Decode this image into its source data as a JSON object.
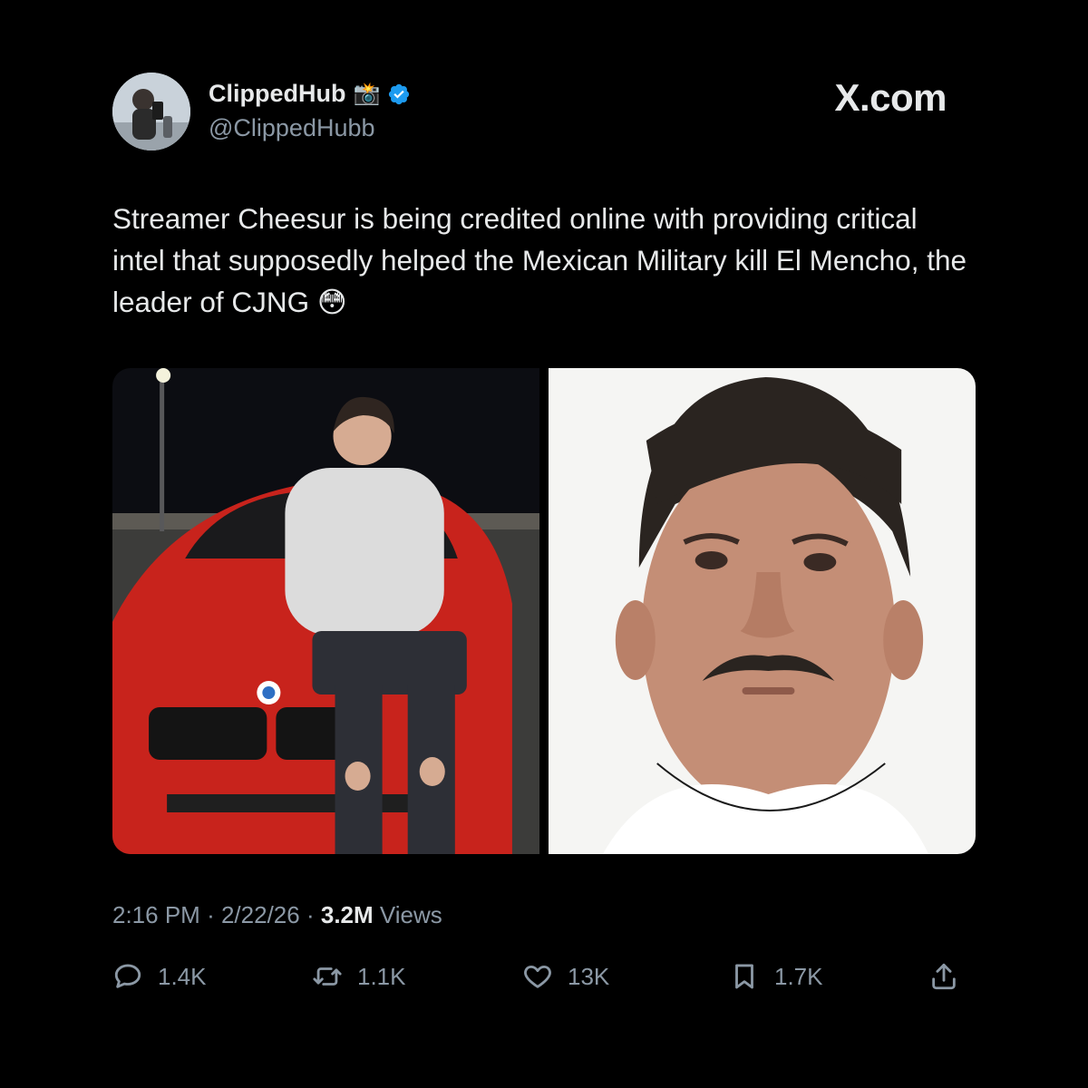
{
  "author": {
    "display_name": "ClippedHub",
    "name_emoji": "📸",
    "handle": "@ClippedHubb",
    "verified": true,
    "verified_color": "#1d9bf0"
  },
  "site_label": "X.com",
  "tweet": {
    "text": "Streamer Cheesur is being credited online with providing critical intel that supposedly helped the Mexican Military kill El Mencho, the leader of CJNG 😳"
  },
  "meta": {
    "time": "2:16 PM",
    "separator": "·",
    "date": "2/22/26",
    "views_count": "3.2M",
    "views_label": "Views"
  },
  "actions": {
    "replies": "1.4K",
    "reposts": "1.1K",
    "likes": "13K",
    "bookmarks": "1.7K"
  },
  "colors": {
    "background": "#000000",
    "text": "#e7e9ea",
    "muted": "#8b98a5"
  }
}
